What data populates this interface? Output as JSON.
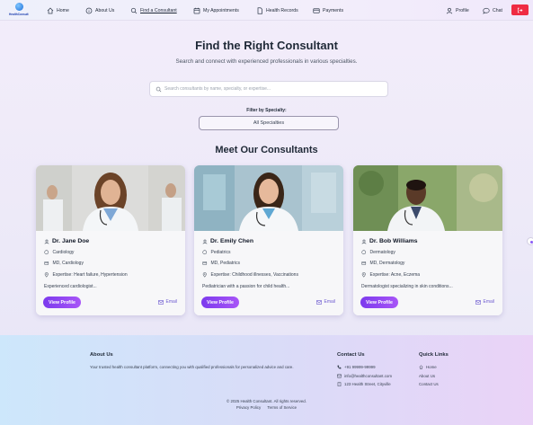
{
  "brand": {
    "logo_text": "HealthConsult"
  },
  "nav": {
    "home": "Home",
    "about": "About Us",
    "find": "Find a Consultant",
    "appointments": "My Appointments",
    "records": "Health Records",
    "payments": "Payments",
    "profile": "Profile",
    "chat": "Chat"
  },
  "hero": {
    "title": "Find the Right Consultant",
    "subtitle": "Search and connect with experienced professionals in various specialties."
  },
  "search": {
    "placeholder": "Search consultants by name, specialty, or expertise..."
  },
  "filter": {
    "label": "Filter by Specialty:",
    "selected": "All Specialties"
  },
  "section_title": "Meet Our Consultants",
  "consultants": [
    {
      "name": "Dr. Jane Doe",
      "specialty": "Cardiology",
      "qualification": "MD, Cardiology",
      "expertise": "Expertise: Heart failure, Hypertension",
      "description": "Experienced cardiologist...",
      "profile_label": "View Profile",
      "email_label": "Email"
    },
    {
      "name": "Dr. Emily Chen",
      "specialty": "Pediatrics",
      "qualification": "MD, Pediatrics",
      "expertise": "Expertise: Childhood illnesses, Vaccinations",
      "description": "Pediatrician with a passion for child health...",
      "profile_label": "View Profile",
      "email_label": "Email"
    },
    {
      "name": "Dr. Bob Williams",
      "specialty": "Dermatology",
      "qualification": "MD, Dermatology",
      "expertise": "Expertise: Acne, Eczema",
      "description": "Dermatologist specializing in skin conditions...",
      "profile_label": "View Profile",
      "email_label": "Email"
    }
  ],
  "footer": {
    "about_heading": "About Us",
    "about_text": "Your trusted health consultant platform, connecting you with qualified professionals for personalized advice and care.",
    "contact_heading": "Contact Us",
    "phone": "+91 99999-99999",
    "email": "info@healthconsultant.com",
    "address": "123 Health Street, Cityville",
    "links_heading": "Quick Links",
    "links": [
      "Home",
      "About Us",
      "Contact Us"
    ],
    "copyright": "© 2025 Health Consultant. All rights reserved.",
    "privacy": "Privacy Policy",
    "terms": "Terms of Service"
  },
  "colors": {
    "accent": "#8b5cf6",
    "logout": "#ef2b43",
    "email_link": "#6d5bd0"
  }
}
